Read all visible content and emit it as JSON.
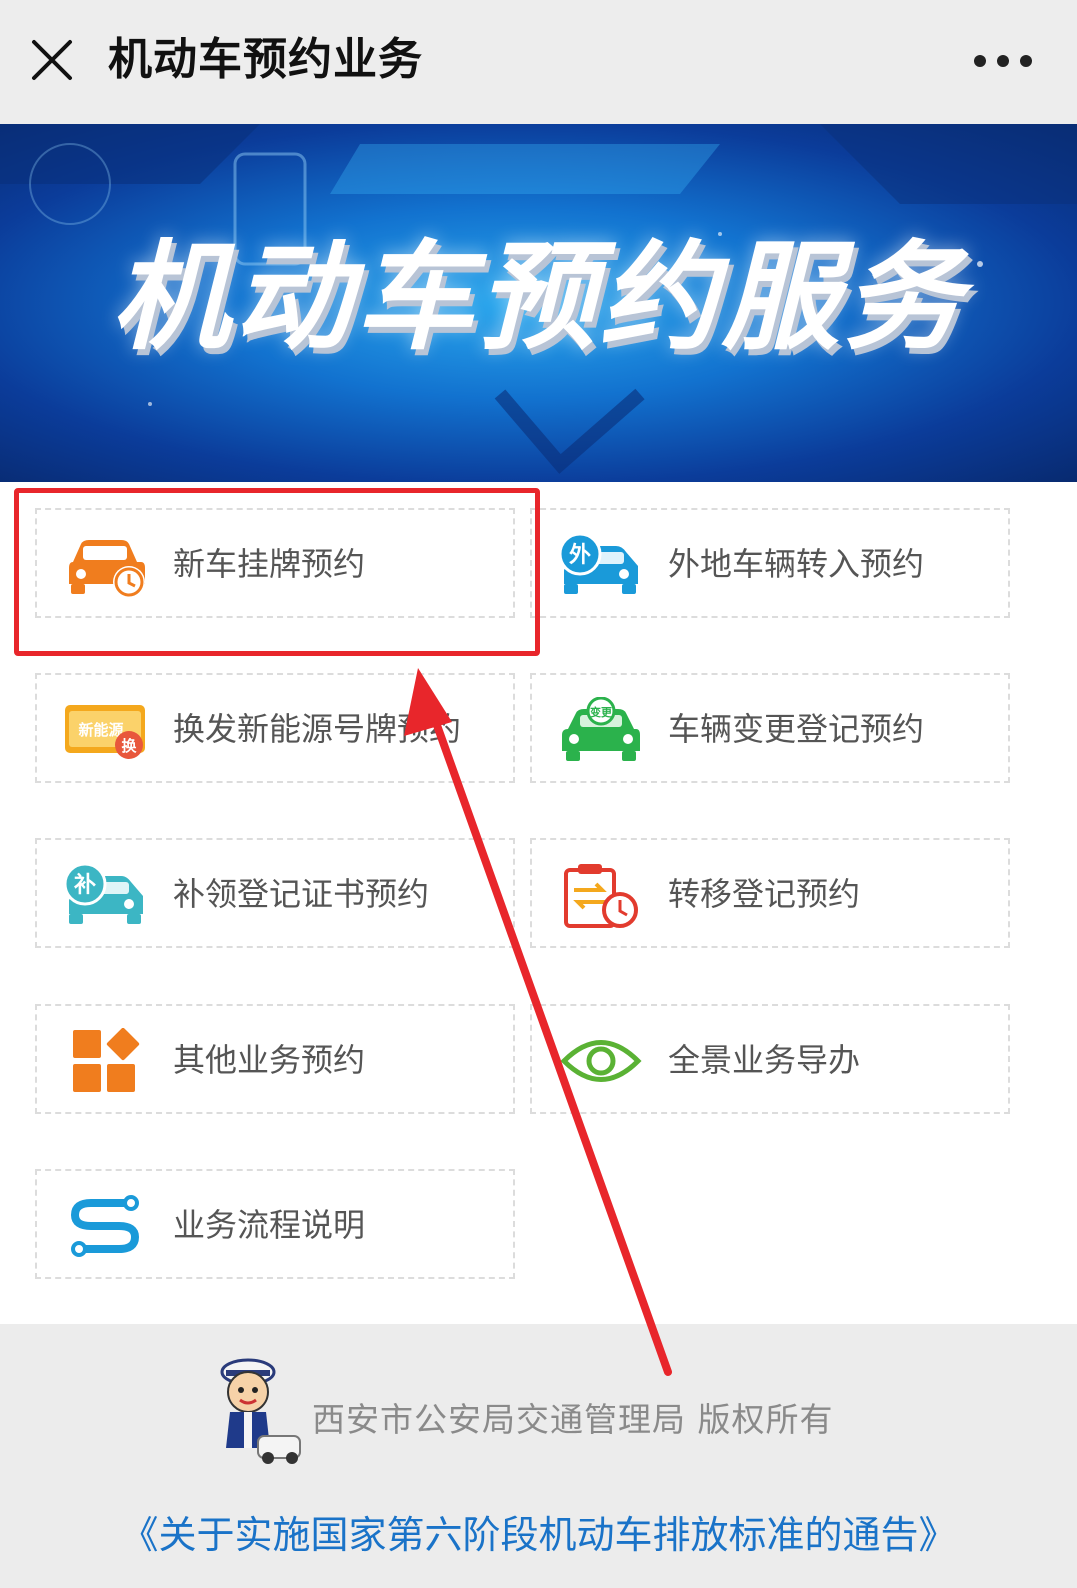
{
  "header": {
    "title": "机动车预约业务",
    "close_icon": "close-icon",
    "more_icon": "more-dots-icon"
  },
  "banner": {
    "title": "机动车预约服务"
  },
  "services": [
    {
      "label": "新车挂牌预约",
      "icon": "new-car-clock-icon",
      "color": "#f07d1e"
    },
    {
      "label": "外地车辆转入预约",
      "icon": "out-of-town-car-icon",
      "color": "#1a9ad9"
    },
    {
      "label": "换发新能源号牌预约",
      "icon": "new-energy-plate-icon",
      "color": "#f4a81d"
    },
    {
      "label": "车辆变更登记预约",
      "icon": "car-change-icon",
      "color": "#2bb24c"
    },
    {
      "label": "补领登记证书预约",
      "icon": "reissue-certificate-car-icon",
      "color": "#3cb6c4"
    },
    {
      "label": "转移登记预约",
      "icon": "transfer-clipboard-icon",
      "color": "#e23b2e"
    },
    {
      "label": "其他业务预约",
      "icon": "other-business-tiles-icon",
      "color": "#f07d1e"
    },
    {
      "label": "全景业务导办",
      "icon": "eye-icon",
      "color": "#5ab234"
    },
    {
      "label": "业务流程说明",
      "icon": "process-flow-icon",
      "color": "#1a9ad9"
    }
  ],
  "footer": {
    "copyright": "西安市公安局交通管理局  版权所有",
    "notice": "《关于实施国家第六阶段机动车排放标准的通告》"
  },
  "colors": {
    "highlight": "#e8262b",
    "arrow": "#e8262b",
    "notice_link": "#1a73c8"
  }
}
